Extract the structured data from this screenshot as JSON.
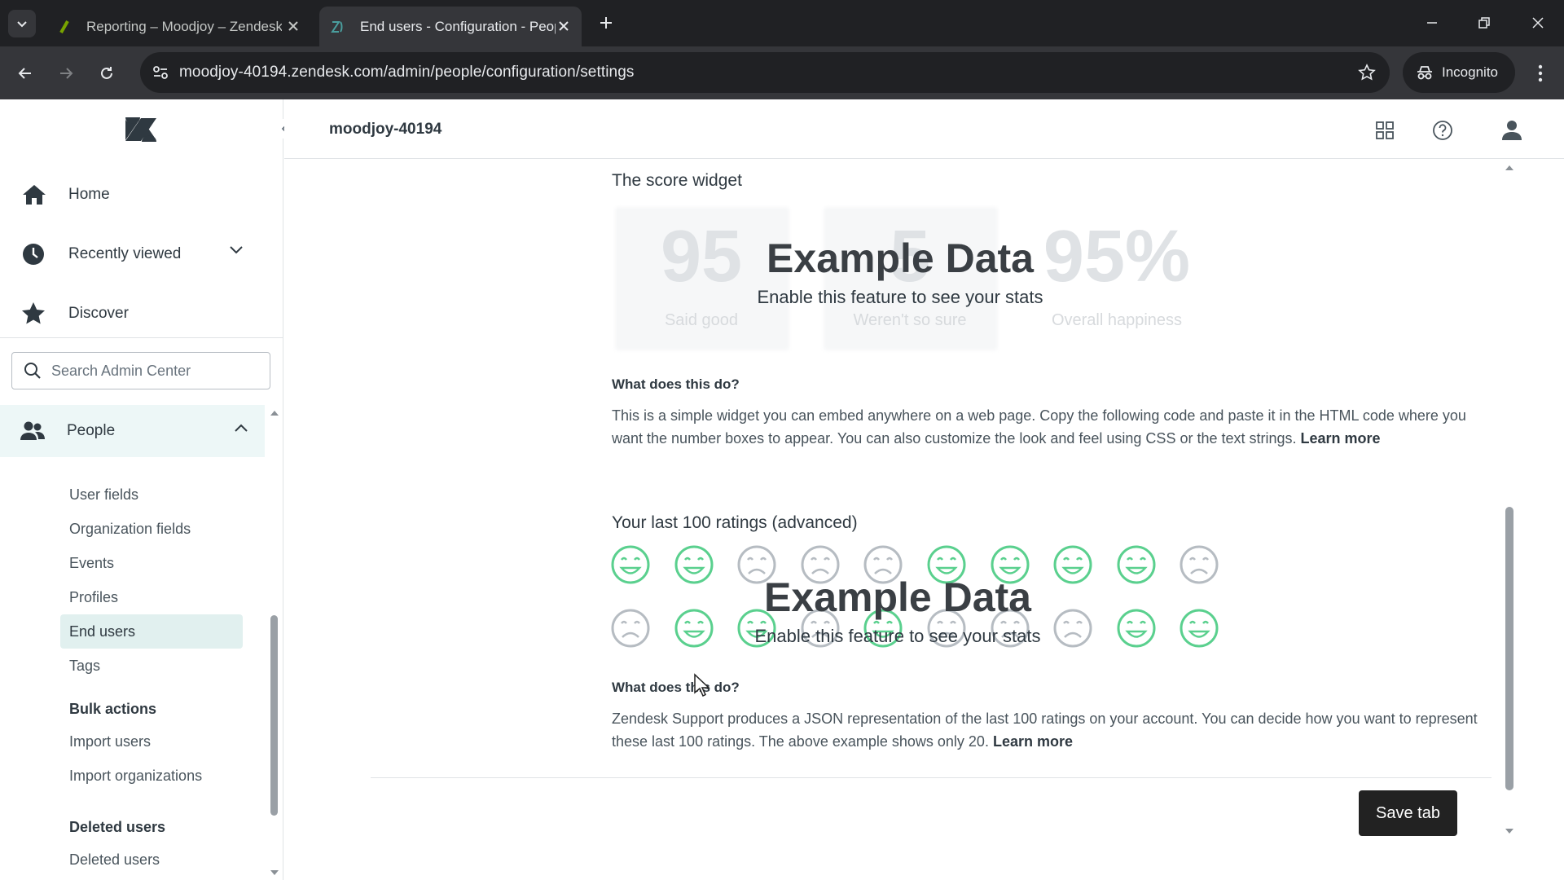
{
  "browser": {
    "tabs": [
      {
        "title": "Reporting – Moodjoy – Zendesk",
        "active": false
      },
      {
        "title": "End users - Configuration - People",
        "active": true
      }
    ],
    "url": "moodjoy-40194.zendesk.com/admin/people/configuration/settings",
    "incognito_label": "Incognito"
  },
  "header": {
    "account": "moodjoy-40194"
  },
  "sidebar": {
    "nav": [
      {
        "label": "Home"
      },
      {
        "label": "Recently viewed"
      },
      {
        "label": "Discover"
      }
    ],
    "search_placeholder": "Search Admin Center",
    "people_label": "People",
    "subitems": [
      {
        "label": "User fields"
      },
      {
        "label": "Organization fields"
      },
      {
        "label": "Events"
      },
      {
        "label": "Profiles"
      },
      {
        "label": "End users"
      },
      {
        "label": "Tags"
      }
    ],
    "groups": {
      "bulk_actions": "Bulk actions",
      "import_users": "Import users",
      "import_organizations": "Import organizations",
      "deleted_users_heading": "Deleted users",
      "deleted_users": "Deleted users"
    }
  },
  "main": {
    "score_widget": {
      "title": "The score widget",
      "stats": [
        {
          "value": "95",
          "caption": "Said good"
        },
        {
          "value": "5",
          "caption": "Weren't so sure"
        },
        {
          "value": "95%",
          "caption": "Overall happiness"
        }
      ],
      "overlay_title": "Example Data",
      "overlay_sub": "Enable this feature to see your stats",
      "question": "What does this do?",
      "description": "This is a simple widget you can embed anywhere on a web page. Copy the following code and paste it in the HTML code where you want the number boxes to appear. You can also customize the look and feel using CSS or the text strings.",
      "learn_more": "Learn more"
    },
    "ratings": {
      "title": "Your last 100 ratings (advanced)",
      "row1": [
        "good",
        "good",
        "bad",
        "bad",
        "bad",
        "good",
        "good",
        "good",
        "good",
        "bad"
      ],
      "row2": [
        "bad",
        "good",
        "good",
        "bad",
        "good",
        "bad",
        "bad",
        "bad",
        "good",
        "good"
      ],
      "overlay_title": "Example Data",
      "overlay_sub": "Enable this feature to see your stats",
      "question": "What does this do?",
      "description": "Zendesk Support produces a JSON representation of the last 100 ratings on your account. You can decide how you want to represent these last 100 ratings. The above example shows only 20.",
      "learn_more": "Learn more"
    },
    "save_label": "Save tab"
  },
  "colors": {
    "good_face": "#5ad08e",
    "bad_face": "#b6bcc2"
  }
}
